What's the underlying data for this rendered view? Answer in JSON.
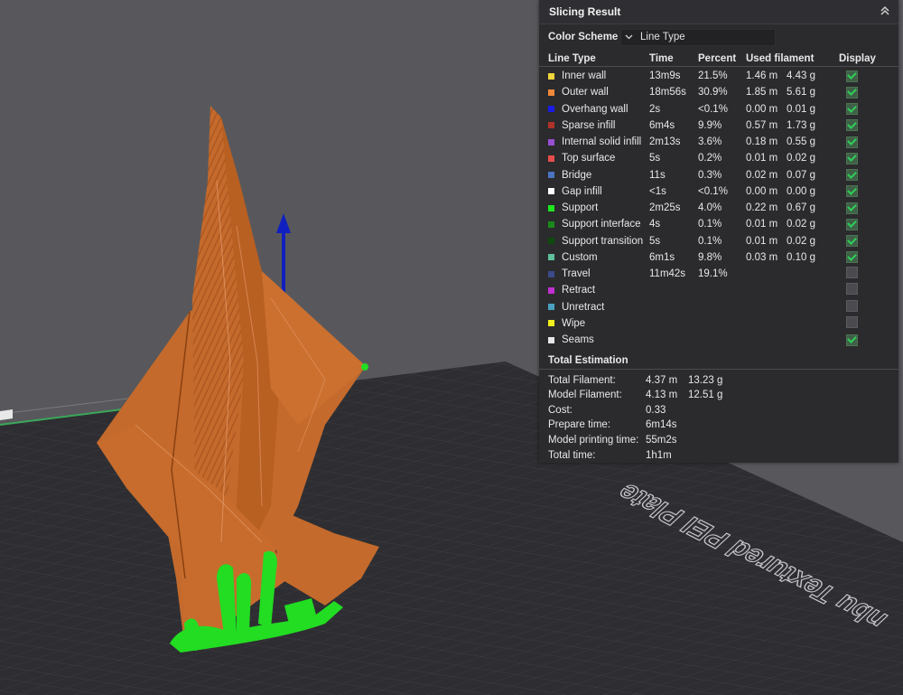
{
  "panel": {
    "title": "Slicing Result",
    "collapse_icon": "chevron-double-up-icon",
    "color_scheme_label": "Color Scheme",
    "color_scheme_value": "Line Type",
    "headers": {
      "line_type": "Line Type",
      "time": "Time",
      "percent": "Percent",
      "used_filament": "Used filament",
      "display": "Display"
    },
    "rows": [
      {
        "name": "Inner wall",
        "color": "#f0d63a",
        "time": "13m9s",
        "percent": "21.5%",
        "length": "1.46 m",
        "weight": "4.43 g",
        "display": true
      },
      {
        "name": "Outer wall",
        "color": "#f08a3a",
        "time": "18m56s",
        "percent": "30.9%",
        "length": "1.85 m",
        "weight": "5.61 g",
        "display": true
      },
      {
        "name": "Overhang wall",
        "color": "#1a1ae6",
        "time": "2s",
        "percent": "<0.1%",
        "length": "0.00 m",
        "weight": "0.01 g",
        "display": true
      },
      {
        "name": "Sparse infill",
        "color": "#b03228",
        "time": "6m4s",
        "percent": "9.9%",
        "length": "0.57 m",
        "weight": "1.73 g",
        "display": true
      },
      {
        "name": "Internal solid infill",
        "color": "#9a4fd0",
        "time": "2m13s",
        "percent": "3.6%",
        "length": "0.18 m",
        "weight": "0.55 g",
        "display": true
      },
      {
        "name": "Top surface",
        "color": "#e84c4c",
        "time": "5s",
        "percent": "0.2%",
        "length": "0.01 m",
        "weight": "0.02 g",
        "display": true
      },
      {
        "name": "Bridge",
        "color": "#4a74c0",
        "time": "11s",
        "percent": "0.3%",
        "length": "0.02 m",
        "weight": "0.07 g",
        "display": true
      },
      {
        "name": "Gap infill",
        "color": "#ffffff",
        "time": "<1s",
        "percent": "<0.1%",
        "length": "0.00 m",
        "weight": "0.00 g",
        "display": true
      },
      {
        "name": "Support",
        "color": "#1ee61e",
        "time": "2m25s",
        "percent": "4.0%",
        "length": "0.22 m",
        "weight": "0.67 g",
        "display": true
      },
      {
        "name": "Support interface",
        "color": "#1a8a1a",
        "time": "4s",
        "percent": "0.1%",
        "length": "0.01 m",
        "weight": "0.02 g",
        "display": true
      },
      {
        "name": "Support transition",
        "color": "#0e4a0e",
        "time": "5s",
        "percent": "0.1%",
        "length": "0.01 m",
        "weight": "0.02 g",
        "display": true
      },
      {
        "name": "Custom",
        "color": "#5ec09a",
        "time": "6m1s",
        "percent": "9.8%",
        "length": "0.03 m",
        "weight": "0.10 g",
        "display": true
      },
      {
        "name": "Travel",
        "color": "#3a4a8a",
        "time": "11m42s",
        "percent": "19.1%",
        "length": "",
        "weight": "",
        "display": false
      },
      {
        "name": "Retract",
        "color": "#c030d0",
        "time": "",
        "percent": "",
        "length": "",
        "weight": "",
        "display": false
      },
      {
        "name": "Unretract",
        "color": "#4aa0c0",
        "time": "",
        "percent": "",
        "length": "",
        "weight": "",
        "display": false
      },
      {
        "name": "Wipe",
        "color": "#f0f01a",
        "time": "",
        "percent": "",
        "length": "",
        "weight": "",
        "display": false
      },
      {
        "name": "Seams",
        "color": "#e8e8e8",
        "time": "",
        "percent": "",
        "length": "",
        "weight": "",
        "display": true
      }
    ],
    "total_title": "Total Estimation",
    "totals": [
      {
        "label": "Total Filament:",
        "v1": "4.37 m",
        "v2": "13.23 g"
      },
      {
        "label": "Model Filament:",
        "v1": "4.13 m",
        "v2": "12.51 g"
      },
      {
        "label": "Cost:",
        "v1": "0.33",
        "v2": ""
      },
      {
        "label": "Prepare time:",
        "v1": "6m14s",
        "v2": ""
      },
      {
        "label": "Model printing time:",
        "v1": "55m2s",
        "v2": ""
      },
      {
        "label": "Total time:",
        "v1": "1h1m",
        "v2": ""
      }
    ]
  },
  "viewport": {
    "plate_label": "nbu Textured PEI Plate",
    "model_color": "#c8692a",
    "support_color": "#22dd22",
    "axis_color": "#1020c0"
  }
}
